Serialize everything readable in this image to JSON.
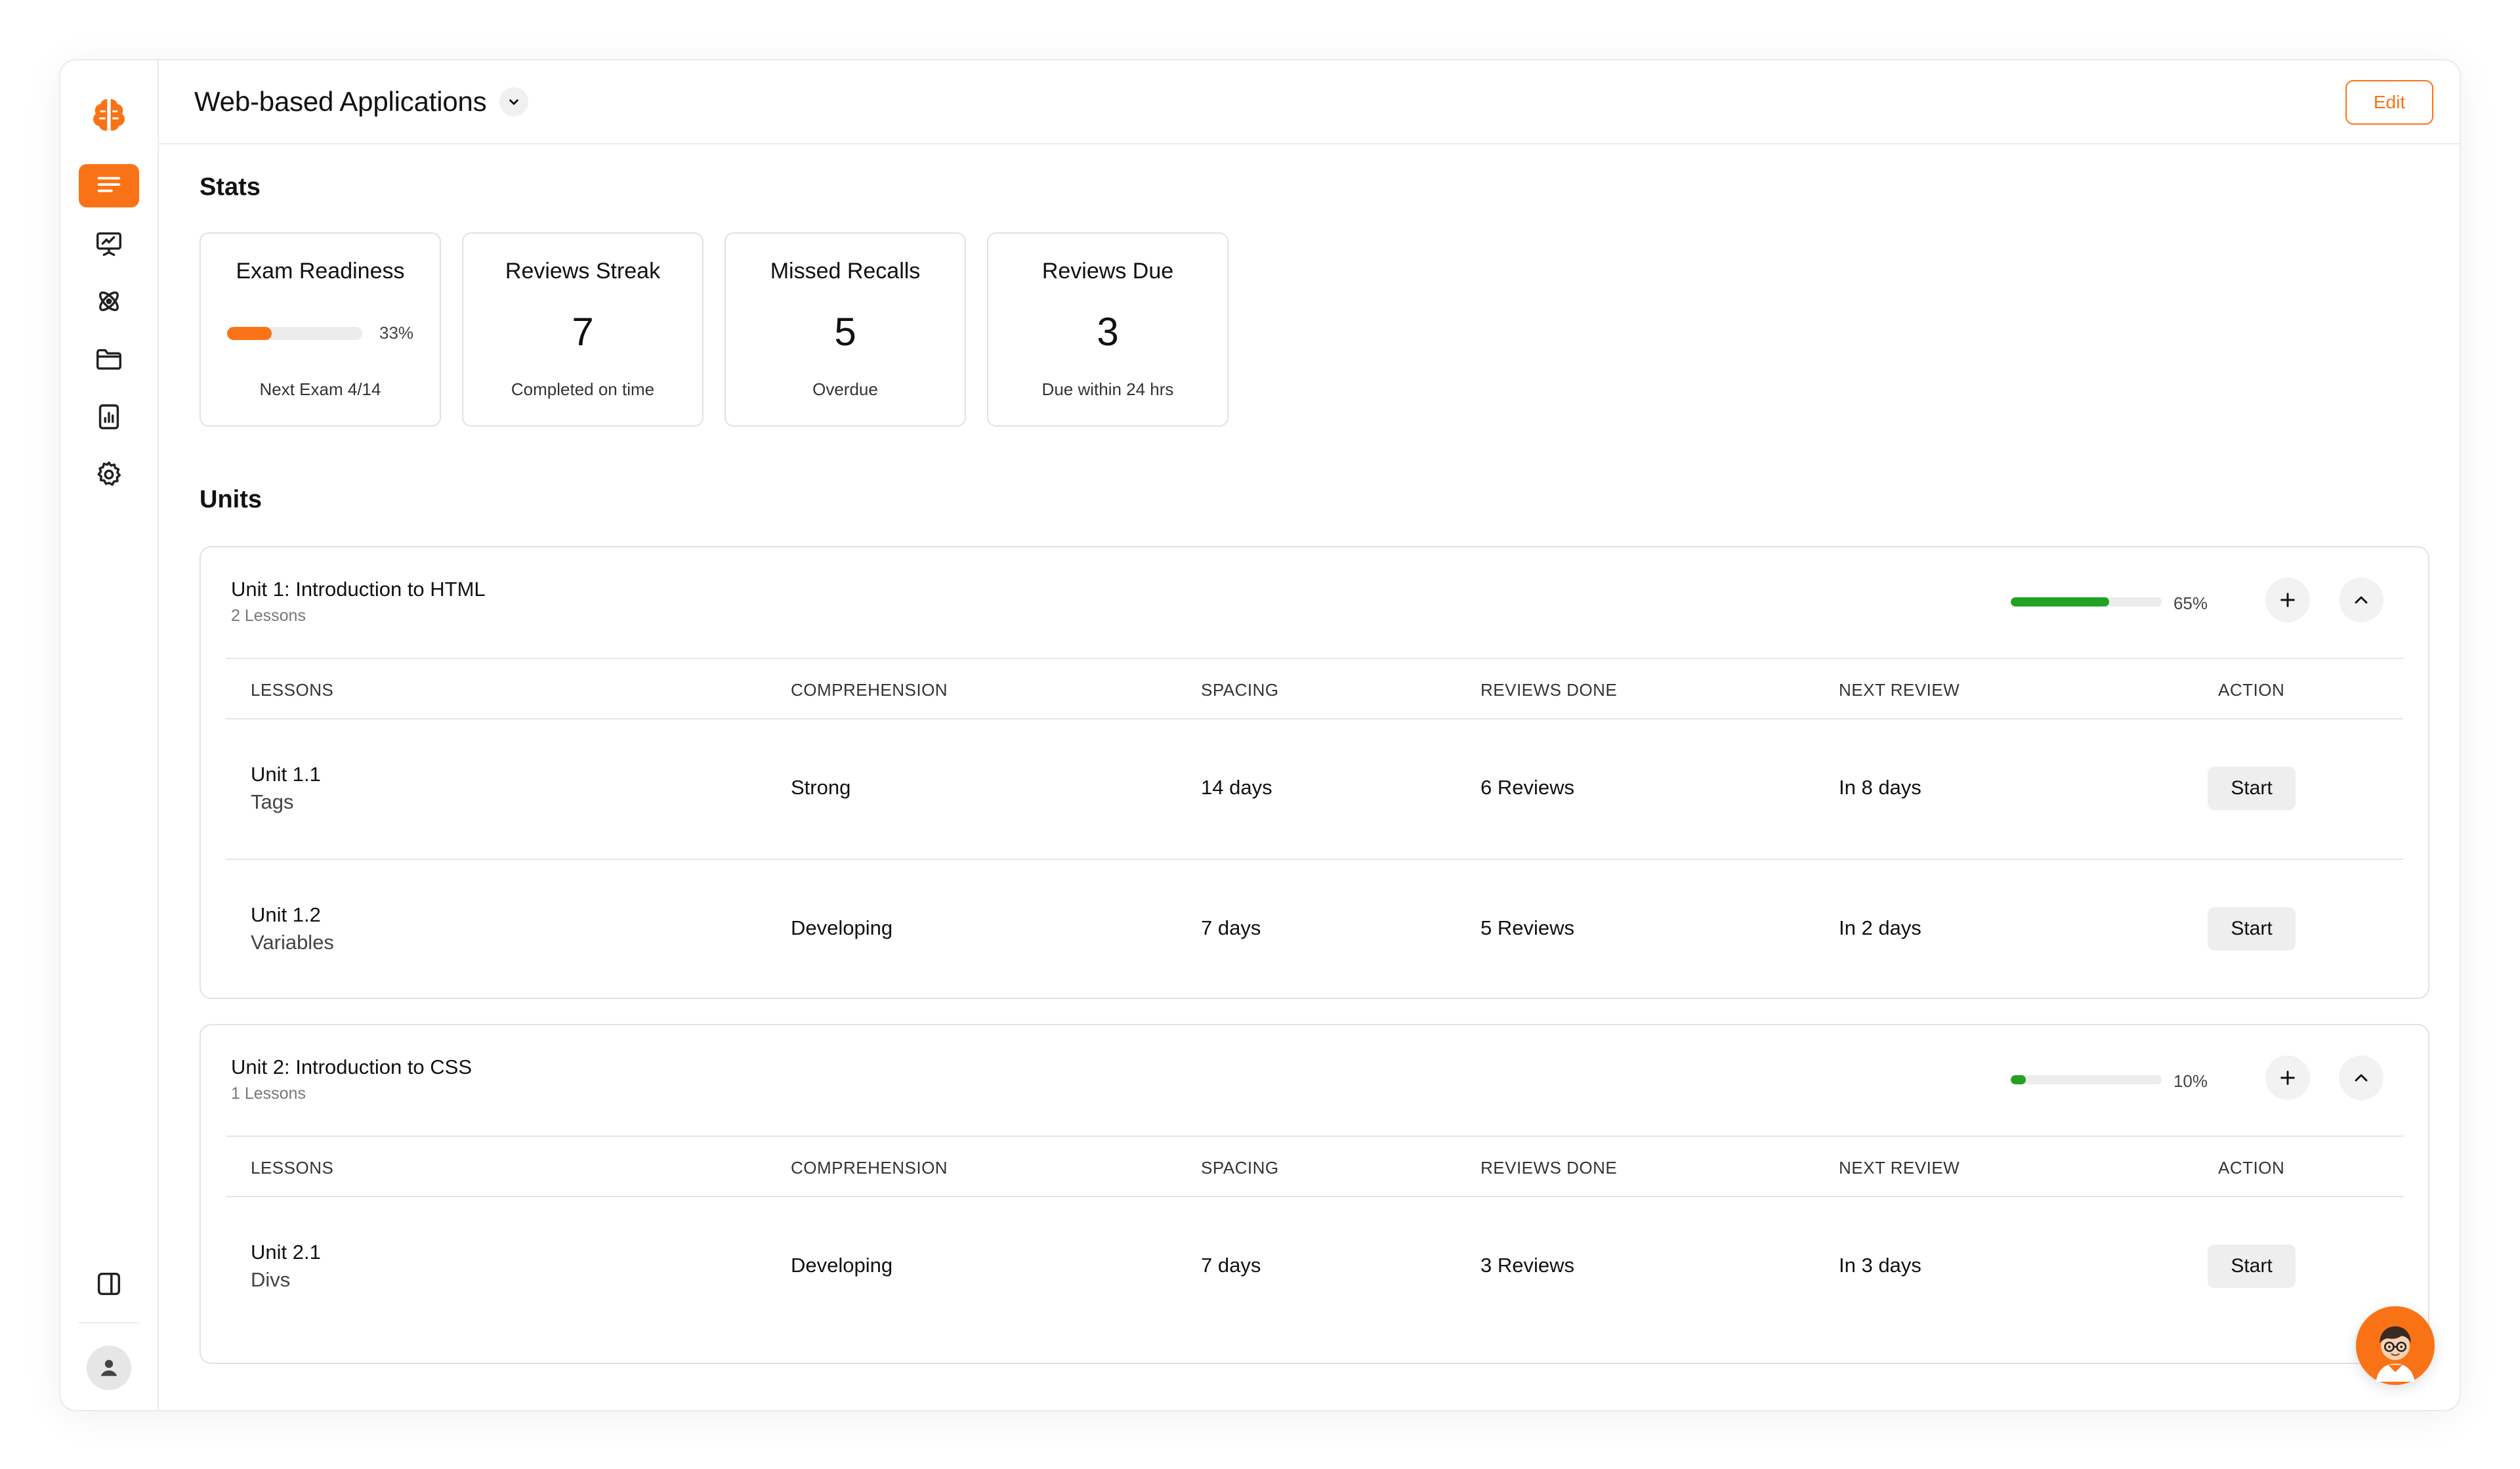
{
  "app": {
    "title": "Web-based Applications",
    "edit_label": "Edit",
    "accent_color": "#f97316",
    "progress_color": "#22a222"
  },
  "sidebar": {
    "items": [
      {
        "icon": "menu-lines-icon",
        "active": true
      },
      {
        "icon": "presentation-board-icon",
        "active": false
      },
      {
        "icon": "atom-icon",
        "active": false
      },
      {
        "icon": "folder-icon",
        "active": false
      },
      {
        "icon": "report-chart-icon",
        "active": false
      },
      {
        "icon": "gear-icon",
        "active": false
      }
    ],
    "bottom": {
      "panel_icon": "panel-toggle-icon",
      "user_icon": "user-avatar-icon"
    }
  },
  "stats": {
    "title": "Stats",
    "cards": [
      {
        "label": "Exam Readiness",
        "progress_percent": 33,
        "value": "33%",
        "sub": "Next Exam 4/14"
      },
      {
        "label": "Reviews Streak",
        "value": "7",
        "sub": "Completed on time"
      },
      {
        "label": "Missed Recalls",
        "value": "5",
        "sub": "Overdue"
      },
      {
        "label": "Reviews Due",
        "value": "3",
        "sub": "Due within 24 hrs"
      }
    ]
  },
  "units": {
    "title": "Units",
    "columns": [
      "LESSONS",
      "COMPREHENSION",
      "SPACING",
      "REVIEWS DONE",
      "NEXT REVIEW",
      "ACTION"
    ],
    "list": [
      {
        "title": "Unit 1: Introduction to HTML",
        "lesson_count": "2 Lessons",
        "progress_percent": 65,
        "progress_label": "65%",
        "lessons": [
          {
            "name": "Unit 1.1",
            "topic": "Tags",
            "comprehension": "Strong",
            "spacing": "14 days",
            "reviews": "6 Reviews",
            "next": "In 8 days",
            "action": "Start"
          },
          {
            "name": "Unit 1.2",
            "topic": "Variables",
            "comprehension": "Developing",
            "spacing": "7 days",
            "reviews": "5 Reviews",
            "next": "In 2 days",
            "action": "Start"
          }
        ]
      },
      {
        "title": "Unit 2: Introduction to CSS",
        "lesson_count": "1 Lessons",
        "progress_percent": 10,
        "progress_label": "10%",
        "lessons": [
          {
            "name": "Unit 2.1",
            "topic": "Divs",
            "comprehension": "Developing",
            "spacing": "7 days",
            "reviews": "3 Reviews",
            "next": "In 3 days",
            "action": "Start"
          }
        ]
      }
    ]
  }
}
